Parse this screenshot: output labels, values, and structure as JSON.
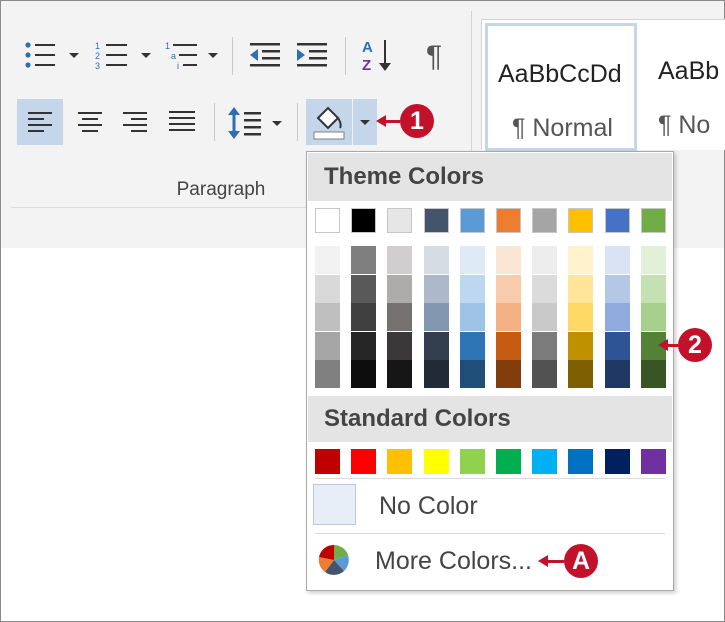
{
  "ribbon": {
    "group_label": "Paragraph",
    "styles": [
      {
        "sample": "AaBbCcDd",
        "name": "¶ Normal"
      },
      {
        "sample": "AaBb",
        "name": "¶ No"
      }
    ]
  },
  "callouts": {
    "one": "1",
    "two": "2",
    "a": "A"
  },
  "shading_menu": {
    "theme_header": "Theme Colors",
    "standard_header": "Standard Colors",
    "no_color": "No Color",
    "more_colors": "More Colors...",
    "theme_colors": [
      "#ffffff",
      "#000000",
      "#e7e6e6",
      "#44546a",
      "#5b9bd5",
      "#ed7d31",
      "#a5a5a5",
      "#ffc000",
      "#4472c4",
      "#70ad47"
    ],
    "theme_shades": [
      [
        "#f2f2f2",
        "#d9d9d9",
        "#bfbfbf",
        "#a6a6a6",
        "#808080"
      ],
      [
        "#7f7f7f",
        "#595959",
        "#404040",
        "#262626",
        "#0d0d0d"
      ],
      [
        "#d0cece",
        "#aeabab",
        "#757171",
        "#3a3838",
        "#171616"
      ],
      [
        "#d6dce4",
        "#adb9ca",
        "#8497b0",
        "#333f4f",
        "#222a35"
      ],
      [
        "#deebf6",
        "#bdd7ee",
        "#9dc3e6",
        "#2e75b5",
        "#1f4e79"
      ],
      [
        "#fbe5d5",
        "#f8cbad",
        "#f4b183",
        "#c55a11",
        "#833c0b"
      ],
      [
        "#ededed",
        "#dbdbdb",
        "#c9c9c9",
        "#7b7b7b",
        "#525252"
      ],
      [
        "#fff2cc",
        "#fee599",
        "#ffd965",
        "#bf9000",
        "#7f6000"
      ],
      [
        "#dae3f3",
        "#b4c7e7",
        "#8faadc",
        "#2f5496",
        "#1f3864"
      ],
      [
        "#e2efd9",
        "#c5e0b3",
        "#a8d08d",
        "#538135",
        "#375623"
      ]
    ],
    "standard_colors": [
      "#c00000",
      "#ff0000",
      "#ffc000",
      "#ffff00",
      "#92d050",
      "#00b050",
      "#00b0f0",
      "#0070c0",
      "#002060",
      "#7030a0"
    ]
  }
}
